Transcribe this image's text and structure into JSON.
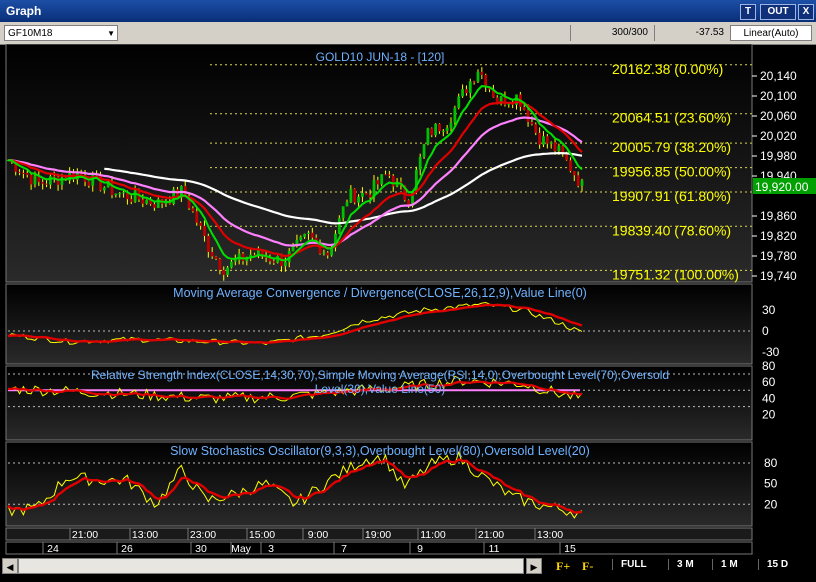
{
  "window": {
    "title": "Graph",
    "buttons": [
      "T",
      "OUT",
      "X"
    ]
  },
  "toolbar": {
    "symbol": "GF10M18",
    "bars": "300/300",
    "change": "-37.53",
    "scale": "Linear(Auto)"
  },
  "colors": {
    "price": "#ffff00",
    "ema_fast": "#00e000",
    "ema_med": "#e00000",
    "ema_slow": "#ff80ff",
    "ema_long": "#ffffff",
    "accent": "#ffd400"
  },
  "main_panel": {
    "title": "GOLD10 JUN-18 - [120]",
    "y_ticks": [
      "20,140",
      "20,100",
      "20,060",
      "20,020",
      "19,980",
      "19,940",
      "19,860",
      "19,820",
      "19,780",
      "19,740"
    ],
    "current_price": "19,920.00",
    "fib_levels": [
      {
        "label": "20162.38 (0.00%)",
        "value": 20162.38
      },
      {
        "label": "20064.51 (23.60%)",
        "value": 20064.51
      },
      {
        "label": "20005.79 (38.20%)",
        "value": 20005.79
      },
      {
        "label": "19956.85 (50.00%)",
        "value": 19956.85
      },
      {
        "label": "19907.91 (61.80%)",
        "value": 19907.91
      },
      {
        "label": "19839.40 (78.60%)",
        "value": 19839.4
      },
      {
        "label": "19751.32 (100.00%)",
        "value": 19751.32
      }
    ]
  },
  "macd_panel": {
    "title": "Moving Average Convergence / Divergence(CLOSE,26,12,9),Value Line(0)",
    "y_ticks": [
      "30",
      "0",
      "-30"
    ]
  },
  "rsi_panel": {
    "title_line1": "Relative Strength Index(CLOSE,14,30,70),Simple Moving Average(RSI,14,0),Overbought Level(70),Oversold",
    "title_line2": "Level(30),Value Line(50)",
    "y_ticks": [
      "80",
      "60",
      "40",
      "20"
    ]
  },
  "stoch_panel": {
    "title": "Slow Stochastics Oscillator(9,3,3),Overbought Level(80),Oversold Level(20)",
    "y_ticks": [
      "80",
      "50",
      "20"
    ]
  },
  "time_axis": {
    "times": [
      "21:00",
      "13:00",
      "23:00",
      "15:00",
      "9:00",
      "19:00",
      "11:00",
      "21:00",
      "13:00"
    ],
    "dates": [
      "24",
      "26",
      "30",
      "May",
      "3",
      "7",
      "9",
      "11",
      "15"
    ]
  },
  "bottom_bar": {
    "f_plus": "F+",
    "f_minus": "F-",
    "ranges": [
      "FULL",
      "3 M",
      "1 M",
      "15 D"
    ]
  }
}
